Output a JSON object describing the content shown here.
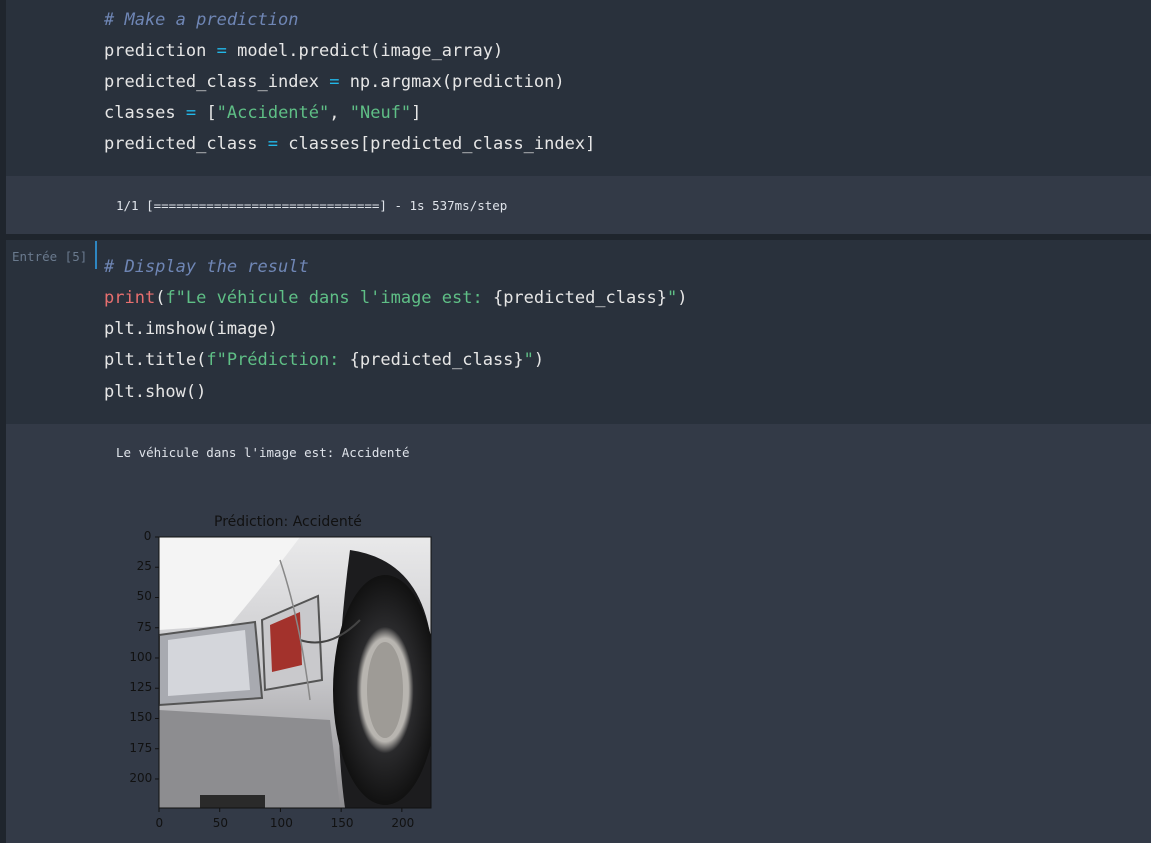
{
  "cell1": {
    "comment": "# Make a prediction",
    "l2_var": "prediction",
    "l2_op": "=",
    "l2_rhs": "model.predict(image_array)",
    "l3_var": "predicted_class_index",
    "l3_op": "=",
    "l3_rhs": "np.argmax(prediction)",
    "l4_var": "classes",
    "l4_op": "=",
    "l4_open": "[",
    "l4_s1": "\"Accidenté\"",
    "l4_sep": ", ",
    "l4_s2": "\"Neuf\"",
    "l4_close": "]",
    "l5_var": "predicted_class",
    "l5_op": "=",
    "l5_rhs": "classes[predicted_class_index]"
  },
  "output1": {
    "progress": "1/1 [==============================] - 1s 537ms/step"
  },
  "cell2": {
    "prompt": "Entrée [5]",
    "comment": "# Display the result",
    "l2_kw": "print",
    "l2_paren": "(",
    "l2_str_a": "f\"Le véhicule dans l'image est: ",
    "l2_expr": "{predicted_class}",
    "l2_str_b": "\"",
    "l2_end": ")",
    "l3": "plt.imshow(image)",
    "l4_a": "plt.title(",
    "l4_str_a": "f\"Prédiction: ",
    "l4_expr": "{predicted_class}",
    "l4_str_b": "\"",
    "l4_end": ")",
    "l5": "plt.show()"
  },
  "output2": {
    "text": "Le véhicule dans l'image est: Accidenté"
  },
  "chart_data": {
    "type": "image",
    "title": "Prédiction: Accidenté",
    "xticks": [
      "0",
      "50",
      "100",
      "150",
      "200"
    ],
    "yticks": [
      "0",
      "25",
      "50",
      "75",
      "100",
      "125",
      "150",
      "175",
      "200"
    ],
    "xlim": [
      0,
      224
    ],
    "ylim": [
      224,
      0
    ],
    "image_description_icon": "damaged-car-front-photo"
  }
}
